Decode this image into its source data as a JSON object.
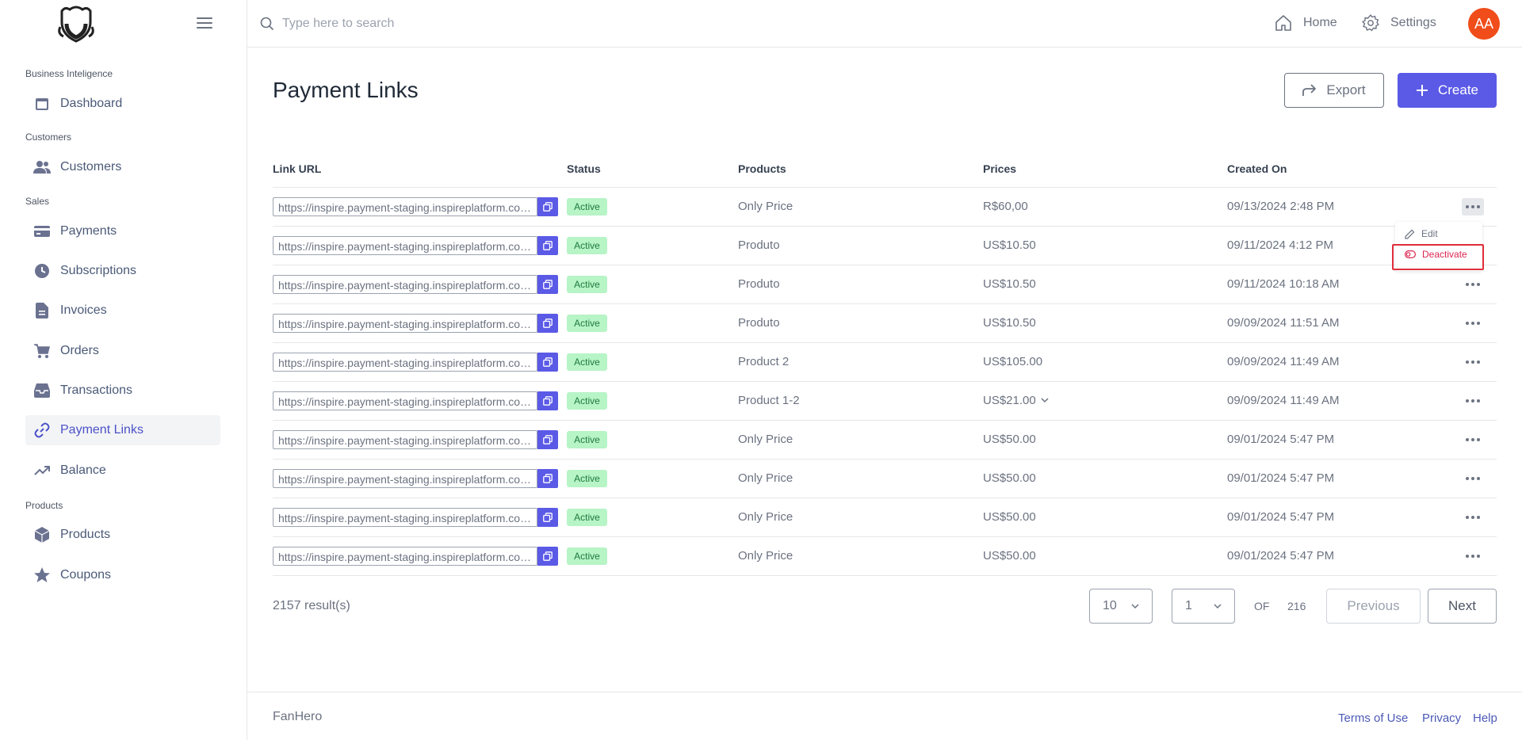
{
  "header": {
    "search_placeholder": "Type here to search",
    "home_label": "Home",
    "settings_label": "Settings",
    "avatar_initials": "AA"
  },
  "sidebar": {
    "sections": [
      {
        "title": "Business Inteligence",
        "items": [
          {
            "label": "Dashboard",
            "icon": "calendar-icon"
          }
        ]
      },
      {
        "title": "Customers",
        "items": [
          {
            "label": "Customers",
            "icon": "users-icon"
          }
        ]
      },
      {
        "title": "Sales",
        "items": [
          {
            "label": "Payments",
            "icon": "credit-card-icon"
          },
          {
            "label": "Subscriptions",
            "icon": "clock-icon"
          },
          {
            "label": "Invoices",
            "icon": "document-icon"
          },
          {
            "label": "Orders",
            "icon": "cart-icon"
          },
          {
            "label": "Transactions",
            "icon": "inbox-icon"
          },
          {
            "label": "Payment Links",
            "icon": "link-icon",
            "active": true
          },
          {
            "label": "Balance",
            "icon": "trending-up-icon"
          }
        ]
      },
      {
        "title": "Products",
        "items": [
          {
            "label": "Products",
            "icon": "cube-icon"
          },
          {
            "label": "Coupons",
            "icon": "star-icon"
          }
        ]
      }
    ]
  },
  "main": {
    "title": "Payment Links",
    "export_label": "Export",
    "create_label": "Create",
    "columns": [
      "Link URL",
      "Status",
      "Products",
      "Prices",
      "Created On"
    ],
    "rows": [
      {
        "url": "https://inspire.payment-staging.inspireplatform.com/",
        "status": "Active",
        "product": "Only Price",
        "price": "R$60,00",
        "created": "09/13/2024 2:48 PM"
      },
      {
        "url": "https://inspire.payment-staging.inspireplatform.com/",
        "status": "Active",
        "product": "Produto",
        "price": "US$10.50",
        "created": "09/11/2024 4:12 PM"
      },
      {
        "url": "https://inspire.payment-staging.inspireplatform.com/",
        "status": "Active",
        "product": "Produto",
        "price": "US$10.50",
        "created": "09/11/2024 10:18 AM"
      },
      {
        "url": "https://inspire.payment-staging.inspireplatform.com/",
        "status": "Active",
        "product": "Produto",
        "price": "US$10.50",
        "created": "09/09/2024 11:51 AM"
      },
      {
        "url": "https://inspire.payment-staging.inspireplatform.com/",
        "status": "Active",
        "product": "Product 2",
        "price": "US$105.00",
        "created": "09/09/2024 11:49 AM"
      },
      {
        "url": "https://inspire.payment-staging.inspireplatform.com/",
        "status": "Active",
        "product": "Product 1-2",
        "price": "US$21.00",
        "price_dropdown": true,
        "created": "09/09/2024 11:49 AM"
      },
      {
        "url": "https://inspire.payment-staging.inspireplatform.com/",
        "status": "Active",
        "product": "Only Price",
        "price": "US$50.00",
        "created": "09/01/2024 5:47 PM"
      },
      {
        "url": "https://inspire.payment-staging.inspireplatform.com/",
        "status": "Active",
        "product": "Only Price",
        "price": "US$50.00",
        "created": "09/01/2024 5:47 PM"
      },
      {
        "url": "https://inspire.payment-staging.inspireplatform.com/",
        "status": "Active",
        "product": "Only Price",
        "price": "US$50.00",
        "created": "09/01/2024 5:47 PM"
      },
      {
        "url": "https://inspire.payment-staging.inspireplatform.com/",
        "status": "Active",
        "product": "Only Price",
        "price": "US$50.00",
        "created": "09/01/2024 5:47 PM"
      }
    ],
    "row_menu": {
      "edit_label": "Edit",
      "deactivate_label": "Deactivate"
    }
  },
  "pagination": {
    "results_text": "2157 result(s)",
    "page_size": "10",
    "current_page": "1",
    "of_label": "OF",
    "total_pages": "216",
    "previous_label": "Previous",
    "next_label": "Next"
  },
  "footer": {
    "brand": "FanHero",
    "links": [
      "Terms of Use",
      "Privacy",
      "Help"
    ]
  },
  "colors": {
    "accent": "#5b5ae6",
    "badge_bg": "#b7f4c6",
    "badge_text": "#1f7a3d",
    "danger": "#dc2650",
    "avatar": "#f04d1a"
  }
}
